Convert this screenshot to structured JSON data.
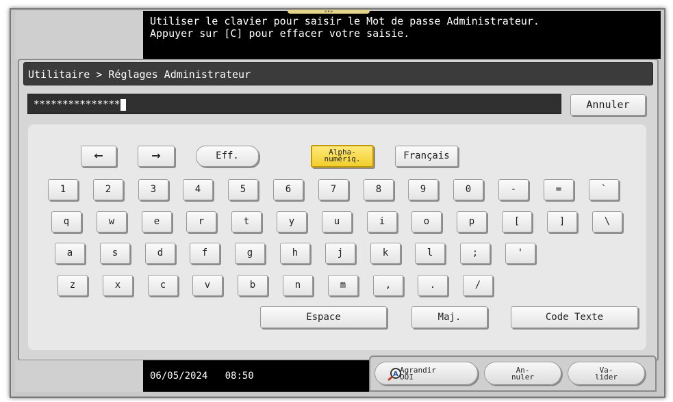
{
  "message": {
    "line1": "Utiliser le clavier pour saisir le Mot de passe Administrateur.",
    "line2": "Appuyer sur [C] pour effacer votre saisie."
  },
  "breadcrumb": "Utilitaire > Réglages Administrateur",
  "password_field": {
    "value": "***************"
  },
  "cancel_button": "Annuler",
  "keyboard": {
    "arrow_left": "←",
    "arrow_right": "→",
    "eff": "Eff.",
    "mode_line1": "Alpha-",
    "mode_line2": "numériq.",
    "language": "Français",
    "row1": [
      "1",
      "2",
      "3",
      "4",
      "5",
      "6",
      "7",
      "8",
      "9",
      "0",
      "-",
      "=",
      "`"
    ],
    "row2": [
      "q",
      "w",
      "e",
      "r",
      "t",
      "y",
      "u",
      "i",
      "o",
      "p",
      "[",
      "]",
      "\\"
    ],
    "row3": [
      "a",
      "s",
      "d",
      "f",
      "g",
      "h",
      "j",
      "k",
      "l",
      ";",
      "'"
    ],
    "row4": [
      "z",
      "x",
      "c",
      "v",
      "b",
      "n",
      "m",
      ",",
      ".",
      "/"
    ],
    "space": "Espace",
    "shift": "Maj.",
    "code": "Code Texte"
  },
  "status": {
    "date": "06/05/2024",
    "time": "08:50"
  },
  "footer": {
    "enlarge_line1": "Agrandir",
    "enlarge_line2": "OOI",
    "cancel_line1": "An-",
    "cancel_line2": "nuler",
    "validate_line1": "Va-",
    "validate_line2": "lider"
  },
  "colors": {
    "mode_active": "#f2cf2e",
    "message_bg": "#000000",
    "title_bg": "#3b3b3b"
  }
}
